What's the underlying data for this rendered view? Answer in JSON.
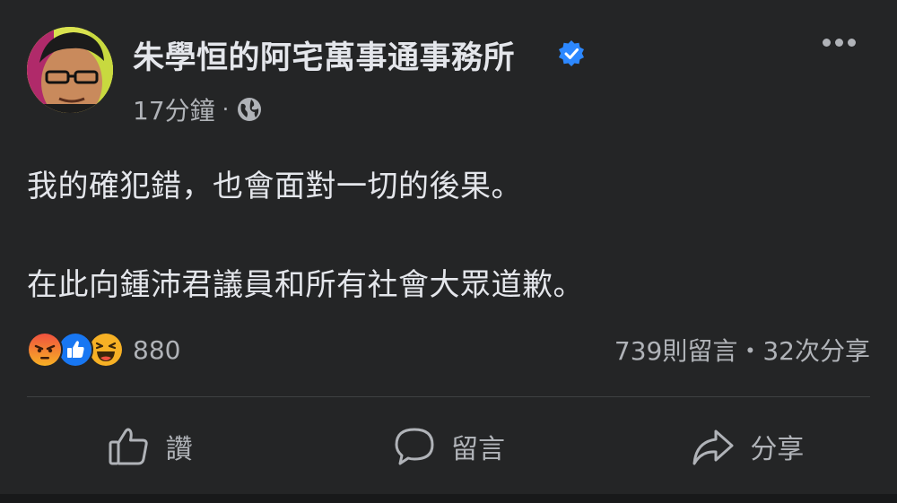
{
  "post": {
    "author": "朱學恒的阿宅萬事通事務所",
    "verified_icon": "verified-badge-icon",
    "timestamp": "17分鐘",
    "separator": "·",
    "audience_icon": "globe-icon",
    "text_lines": [
      "我的確犯錯，也會面對一切的後果。",
      "在此向鍾沛君議員和所有社會大眾道歉。"
    ]
  },
  "reactions": {
    "icons": [
      "angry-icon",
      "like-icon",
      "haha-icon"
    ],
    "count": "880"
  },
  "engagement": {
    "summary": "739則留言・32次分享"
  },
  "actions": {
    "like_label": "讚",
    "comment_label": "留言",
    "share_label": "分享"
  },
  "colors": {
    "background": "#242526",
    "primary_text": "#e4e6eb",
    "secondary_text": "#b0b3b8",
    "verified_blue": "#2d88ff",
    "like_blue": "#1877f2",
    "angry_orange": "#e9710f",
    "haha_yellow": "#f7b125"
  }
}
